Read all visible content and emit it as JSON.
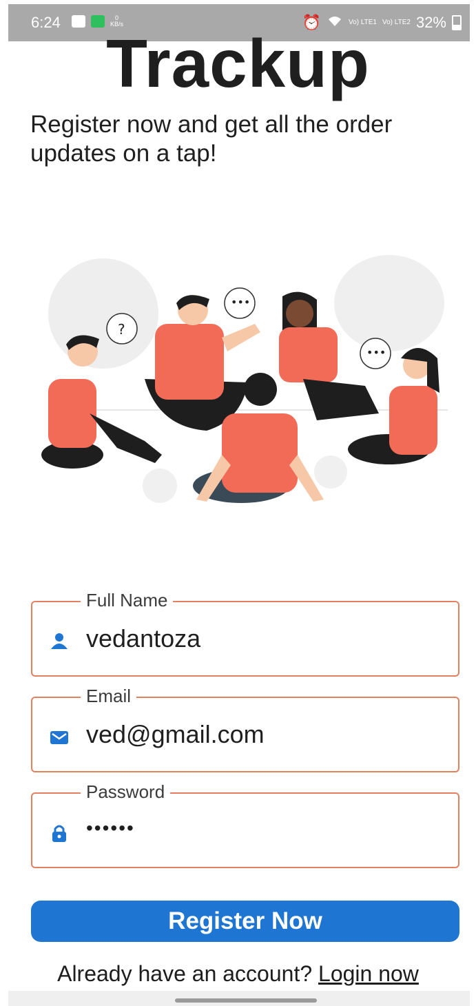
{
  "status_bar": {
    "time": "6:24",
    "data_speed": "0",
    "data_unit": "KB/s",
    "sim1": "Vo) LTE1",
    "sim2": "Vo) LTE2",
    "battery": "32%"
  },
  "header": {
    "title": "Trackup",
    "subtitle": "Register now and get all the order updates on a tap!"
  },
  "form": {
    "full_name": {
      "label": "Full Name",
      "value": "vedantoza",
      "icon": "person-icon"
    },
    "email": {
      "label": "Email",
      "value": "ved@gmail.com",
      "icon": "mail-icon"
    },
    "password": {
      "label": "Password",
      "value": "••••••",
      "icon": "lock-icon"
    }
  },
  "register_button": "Register Now",
  "login_prompt": {
    "text": "Already have an account?",
    "link": "Login now"
  },
  "colors": {
    "accent": "#1f76d2",
    "field_border": "#e3805f",
    "shirt": "#f26b57",
    "status_bar": "#a9a9a9"
  }
}
